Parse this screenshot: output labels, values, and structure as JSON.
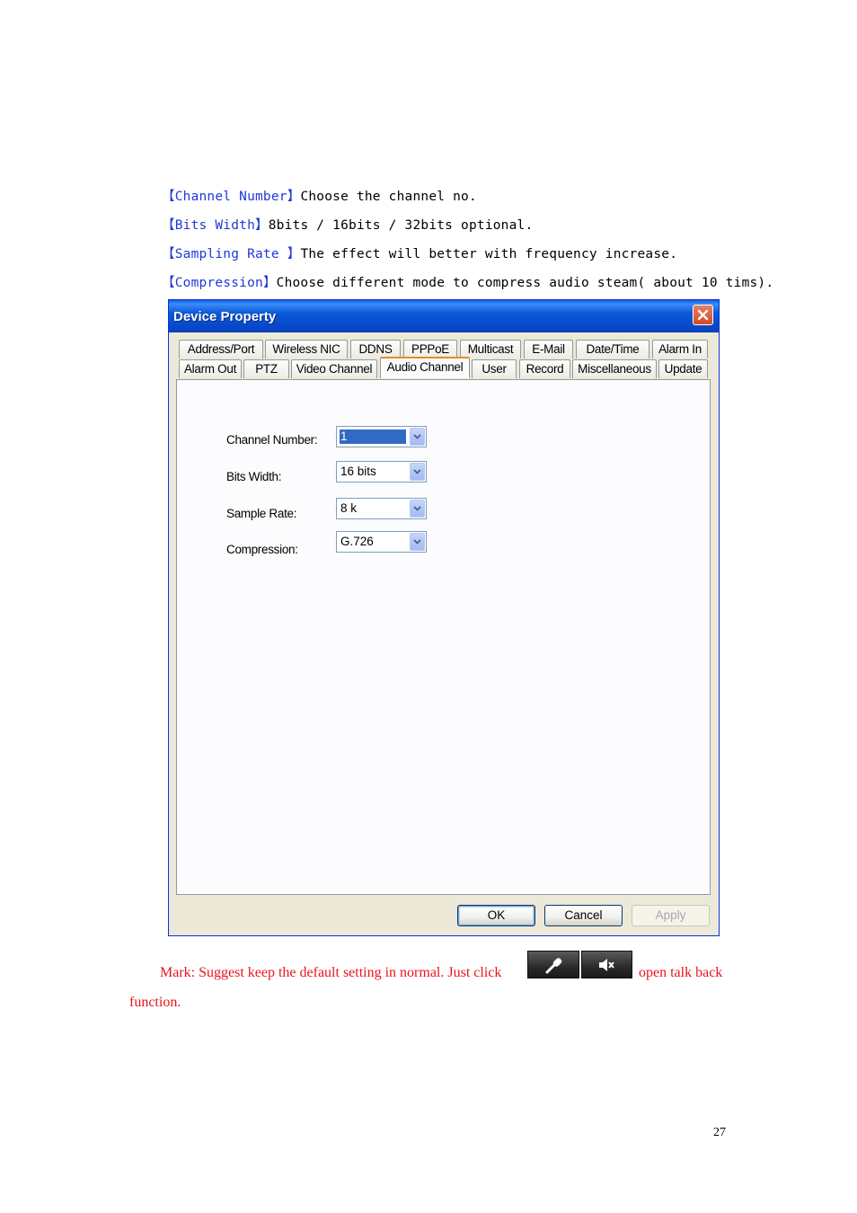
{
  "doc": {
    "lines": [
      {
        "open": "【",
        "term": "Channel Number",
        "close": "】",
        "text": "Choose the channel no."
      },
      {
        "open": "【",
        "term": "Bits Width",
        "close": "】",
        "text": "8bits / 16bits / 32bits optional."
      },
      {
        "open": "【",
        "term": "Sampling Rate ",
        "close": "】",
        "text": "The effect will better with frequency increase."
      },
      {
        "open": "【",
        "term": "Compression",
        "close": "】",
        "text": "Choose different mode to compress audio steam( about 10 tims)."
      }
    ],
    "mark_line1": "Mark: Suggest keep the default setting in normal. Just click",
    "mark_line1_after": "open talk back",
    "mark_line2": "function.",
    "talk_buttons": [
      "microphone-icon",
      "speaker-icon"
    ],
    "page_number": "27"
  },
  "dialog": {
    "title": "Device Property",
    "tabs_row1": [
      "Address/Port",
      "Wireless NIC",
      "DDNS",
      "PPPoE",
      "Multicast",
      "E-Mail",
      "Date/Time",
      "Alarm In"
    ],
    "tabs_row2": [
      "Alarm Out",
      "PTZ",
      "Video Channel",
      "Audio Channel",
      "User",
      "Record",
      "Miscellaneous",
      "Update"
    ],
    "active_tab": "Audio Channel",
    "fields": {
      "channel_number": {
        "label": "Channel Number:",
        "value": "1"
      },
      "bits_width": {
        "label": "Bits Width:",
        "value": "16 bits"
      },
      "sample_rate": {
        "label": "Sample Rate:",
        "value": "8 k"
      },
      "compression": {
        "label": "Compression:",
        "value": "G.726"
      }
    },
    "buttons": {
      "ok": "OK",
      "cancel": "Cancel",
      "apply": "Apply"
    },
    "colors": {
      "title_bar": "#0b5ad9",
      "active_tab_accent": "#e68b2c",
      "dialog_bg": "#ece9d8",
      "close_button": "#d34b23"
    }
  }
}
